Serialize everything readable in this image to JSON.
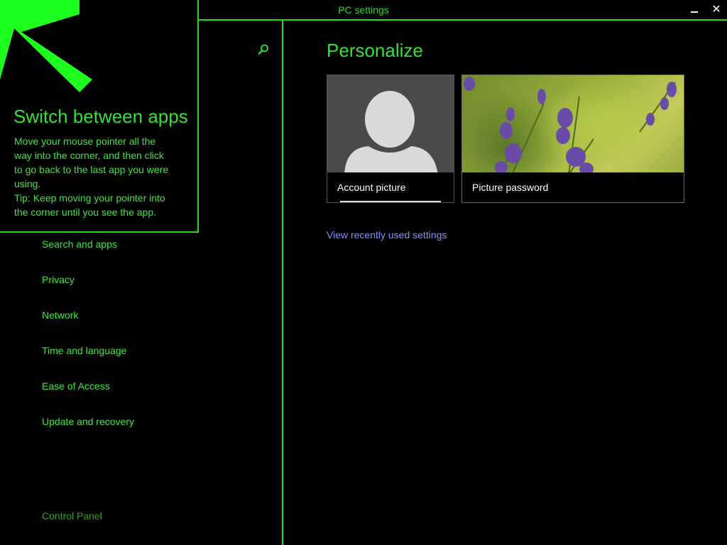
{
  "window": {
    "title": "PC settings",
    "minimize_glyph": "_",
    "close_glyph": "✕"
  },
  "tip": {
    "title": "Switch between apps",
    "body_lines": [
      "Move your mouse pointer all the",
      "way into the corner, and then click",
      "to go back to the last app you were",
      "using.",
      "Tip: Keep moving your pointer into",
      "the corner until you see the app."
    ],
    "arrow_icon": "arrow-up-left-icon"
  },
  "sidebar": {
    "search_icon": "search-icon",
    "items": [
      {
        "label": "Search and apps"
      },
      {
        "label": "Privacy"
      },
      {
        "label": "Network"
      },
      {
        "label": "Time and language"
      },
      {
        "label": "Ease of Access"
      },
      {
        "label": "Update and recovery"
      }
    ],
    "control_panel_label": "Control Panel"
  },
  "main": {
    "title": "Personalize",
    "tiles": {
      "account": {
        "label": "Account picture"
      },
      "password": {
        "label": "Picture password"
      }
    },
    "recent_link": "View recently used settings"
  },
  "colors": {
    "accent": "#1fdc1f",
    "text": "#3ee53e",
    "link": "#8b8bff",
    "background": "#000000"
  }
}
